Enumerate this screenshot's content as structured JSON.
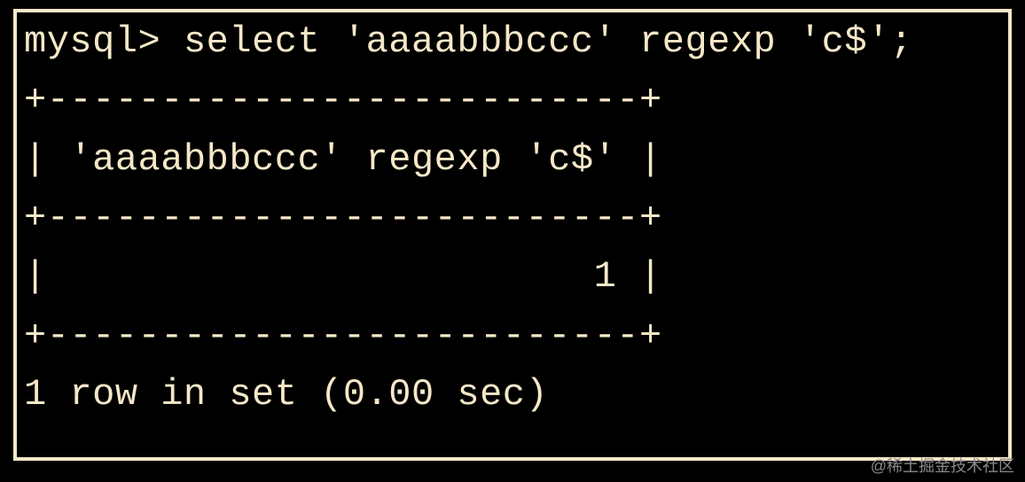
{
  "terminal": {
    "prompt": "mysql>",
    "command": "select 'aaaabbbccc' regexp 'c$';",
    "table": {
      "border": "+--------------------------+",
      "header": "| 'aaaabbbccc' regexp 'c$' |",
      "datarow": "|                        1 |"
    },
    "footer": "1 row in set (0.00 sec)"
  },
  "watermark": "@稀土掘金技术社区"
}
